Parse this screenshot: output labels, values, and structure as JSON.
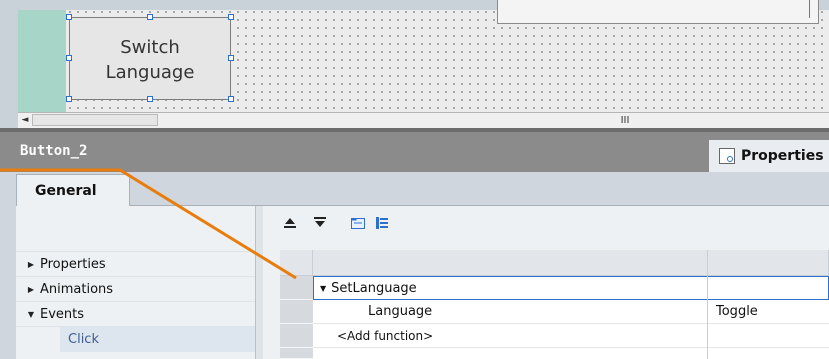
{
  "canvas": {
    "button_label": "Switch\nLanguage"
  },
  "scrollbar": {
    "left_arrow": "◄",
    "grip": "III"
  },
  "inspector": {
    "title": "Button_2",
    "properties_tab": "Properties",
    "tabs": [
      "General"
    ]
  },
  "nav": {
    "items": [
      {
        "label": "Properties",
        "expanded": false
      },
      {
        "label": "Animations",
        "expanded": false
      },
      {
        "label": "Events",
        "expanded": true
      }
    ],
    "selected_child": "Click"
  },
  "toolbar": {
    "icons": [
      "move-up-icon",
      "move-down-icon",
      "folder-icon",
      "list-icon"
    ],
    "move_up": "⇞",
    "move_down": "⇟"
  },
  "function_list": {
    "function_name": "SetLanguage",
    "param_name": "Language",
    "param_value": "Toggle",
    "add_function": "<Add function>"
  },
  "colors": {
    "accent_orange": "#e87d0d",
    "selection_blue": "#2f6fd0",
    "header_gray": "#8b8b8b"
  }
}
